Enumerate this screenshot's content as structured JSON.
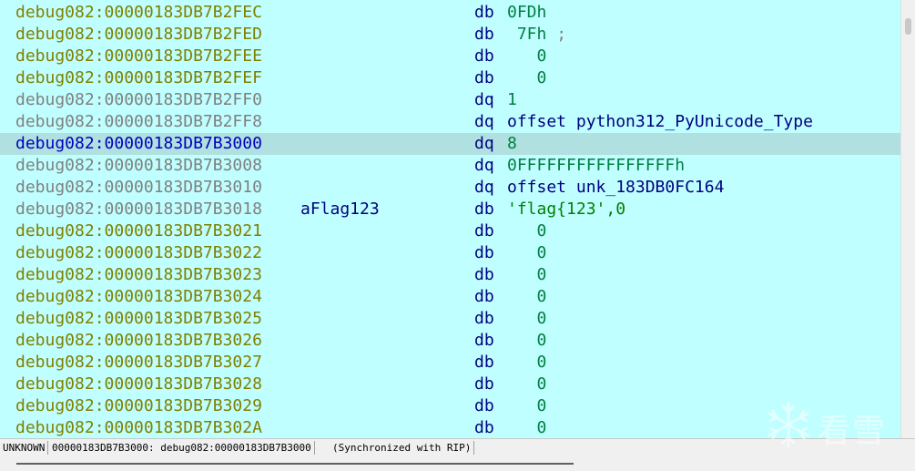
{
  "rows": [
    {
      "addr": "debug082:00000183DB7B2FEC",
      "label": "",
      "ins": "db",
      "op": "0FDh",
      "op_kind": "num",
      "comment": "",
      "addr_color": "olive",
      "selected": false
    },
    {
      "addr": "debug082:00000183DB7B2FED",
      "label": "",
      "ins": "db",
      "op": " 7Fh",
      "op_kind": "num",
      "comment": " ;",
      "addr_color": "olive",
      "selected": false
    },
    {
      "addr": "debug082:00000183DB7B2FEE",
      "label": "",
      "ins": "db",
      "op": "   0",
      "op_kind": "num",
      "comment": "",
      "addr_color": "olive",
      "selected": false
    },
    {
      "addr": "debug082:00000183DB7B2FEF",
      "label": "",
      "ins": "db",
      "op": "   0",
      "op_kind": "num",
      "comment": "",
      "addr_color": "olive",
      "selected": false
    },
    {
      "addr": "debug082:00000183DB7B2FF0",
      "label": "",
      "ins": "dq",
      "op": "1",
      "op_kind": "num",
      "comment": "",
      "addr_color": "gray",
      "selected": false
    },
    {
      "addr": "debug082:00000183DB7B2FF8",
      "label": "",
      "ins": "dq",
      "op": "offset python312_PyUnicode_Type",
      "op_kind": "sym",
      "comment": "",
      "addr_color": "gray",
      "selected": false
    },
    {
      "addr": "debug082:00000183DB7B3000",
      "label": "",
      "ins": "dq",
      "op": "8",
      "op_kind": "num",
      "comment": "",
      "addr_color": "blue",
      "selected": true
    },
    {
      "addr": "debug082:00000183DB7B3008",
      "label": "",
      "ins": "dq",
      "op": "0FFFFFFFFFFFFFFFFh",
      "op_kind": "num",
      "comment": "",
      "addr_color": "gray",
      "selected": false
    },
    {
      "addr": "debug082:00000183DB7B3010",
      "label": "",
      "ins": "dq",
      "op": "offset unk_183DB0FC164",
      "op_kind": "sym",
      "comment": "",
      "addr_color": "gray",
      "selected": false
    },
    {
      "addr": "debug082:00000183DB7B3018",
      "label": "aFlag123",
      "ins": "db",
      "op": "'flag{123',0",
      "op_kind": "str",
      "comment": "",
      "addr_color": "gray",
      "selected": false
    },
    {
      "addr": "debug082:00000183DB7B3021",
      "label": "",
      "ins": "db",
      "op": "   0",
      "op_kind": "num",
      "comment": "",
      "addr_color": "olive",
      "selected": false
    },
    {
      "addr": "debug082:00000183DB7B3022",
      "label": "",
      "ins": "db",
      "op": "   0",
      "op_kind": "num",
      "comment": "",
      "addr_color": "olive",
      "selected": false
    },
    {
      "addr": "debug082:00000183DB7B3023",
      "label": "",
      "ins": "db",
      "op": "   0",
      "op_kind": "num",
      "comment": "",
      "addr_color": "olive",
      "selected": false
    },
    {
      "addr": "debug082:00000183DB7B3024",
      "label": "",
      "ins": "db",
      "op": "   0",
      "op_kind": "num",
      "comment": "",
      "addr_color": "olive",
      "selected": false
    },
    {
      "addr": "debug082:00000183DB7B3025",
      "label": "",
      "ins": "db",
      "op": "   0",
      "op_kind": "num",
      "comment": "",
      "addr_color": "olive",
      "selected": false
    },
    {
      "addr": "debug082:00000183DB7B3026",
      "label": "",
      "ins": "db",
      "op": "   0",
      "op_kind": "num",
      "comment": "",
      "addr_color": "olive",
      "selected": false
    },
    {
      "addr": "debug082:00000183DB7B3027",
      "label": "",
      "ins": "db",
      "op": "   0",
      "op_kind": "num",
      "comment": "",
      "addr_color": "olive",
      "selected": false
    },
    {
      "addr": "debug082:00000183DB7B3028",
      "label": "",
      "ins": "db",
      "op": "   0",
      "op_kind": "num",
      "comment": "",
      "addr_color": "olive",
      "selected": false
    },
    {
      "addr": "debug082:00000183DB7B3029",
      "label": "",
      "ins": "db",
      "op": "   0",
      "op_kind": "num",
      "comment": "",
      "addr_color": "olive",
      "selected": false
    },
    {
      "addr": "debug082:00000183DB7B302A",
      "label": "",
      "ins": "db",
      "op": "   0",
      "op_kind": "num",
      "comment": "",
      "addr_color": "olive",
      "selected": false
    }
  ],
  "status": {
    "mode": "UNKNOWN",
    "location": "00000183DB7B3000: debug082:00000183DB7B3000",
    "sync": "(Synchronized with RIP)"
  },
  "watermark": {
    "text": "看雪",
    "icon": "snowflake-logo"
  },
  "colors": {
    "view_bg": "#c0ffff",
    "selected_bg": "#b0e0e0",
    "addr_olive": "#808000",
    "addr_gray": "#808080",
    "addr_blue": "#0000c0"
  }
}
